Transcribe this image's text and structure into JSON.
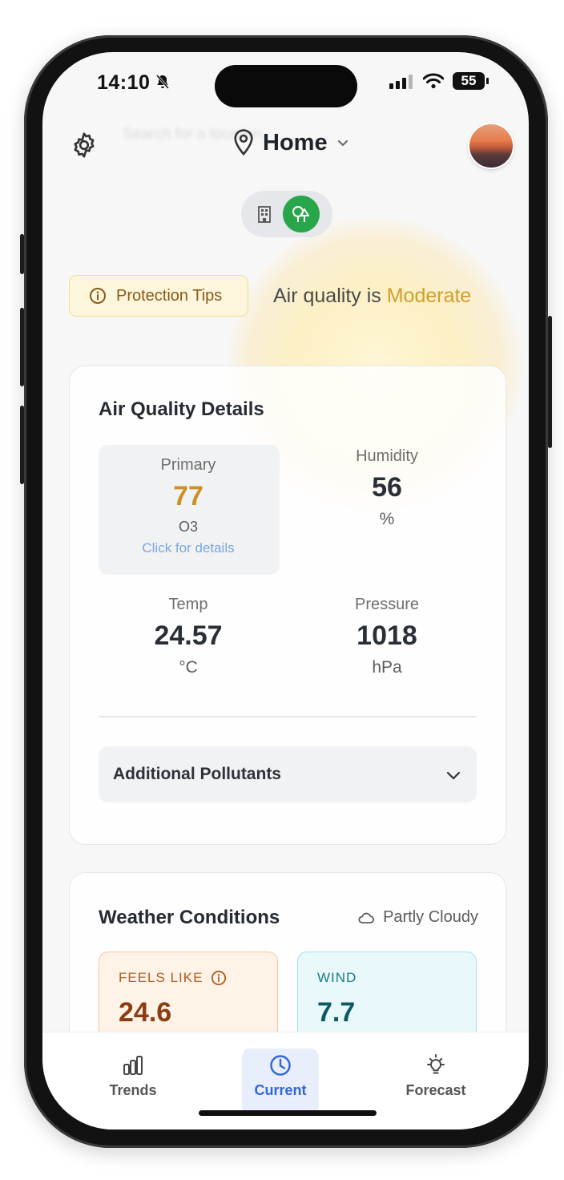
{
  "status_bar": {
    "time": "14:10",
    "battery": "55"
  },
  "header": {
    "location": "Home",
    "search_placeholder": "Search for a location"
  },
  "banner": {
    "tips_label": "Protection Tips",
    "status_prefix": "Air quality is ",
    "status_level": "Moderate"
  },
  "air_quality": {
    "title": "Air Quality Details",
    "primary": {
      "label": "Primary",
      "value": "77",
      "pollutant": "O3",
      "link": "Click for details"
    },
    "humidity": {
      "label": "Humidity",
      "value": "56",
      "unit": "%"
    },
    "temp": {
      "label": "Temp",
      "value": "24.57",
      "unit": "°C"
    },
    "pressure": {
      "label": "Pressure",
      "value": "1018",
      "unit": "hPa"
    },
    "pollutants_label": "Additional Pollutants"
  },
  "weather": {
    "title": "Weather Conditions",
    "condition": "Partly Cloudy",
    "feels_like": {
      "label": "FEELS LIKE",
      "value": "24.6"
    },
    "wind": {
      "label": "WIND",
      "value": "7.7"
    }
  },
  "tabs": [
    {
      "label": "Trends",
      "icon": "bar-chart-icon"
    },
    {
      "label": "Current",
      "icon": "clock-icon"
    },
    {
      "label": "Forecast",
      "icon": "lightbulb-icon"
    }
  ],
  "colors": {
    "accent": "#3366d6",
    "moderate": "#d29e2a",
    "green": "#27a64a"
  }
}
